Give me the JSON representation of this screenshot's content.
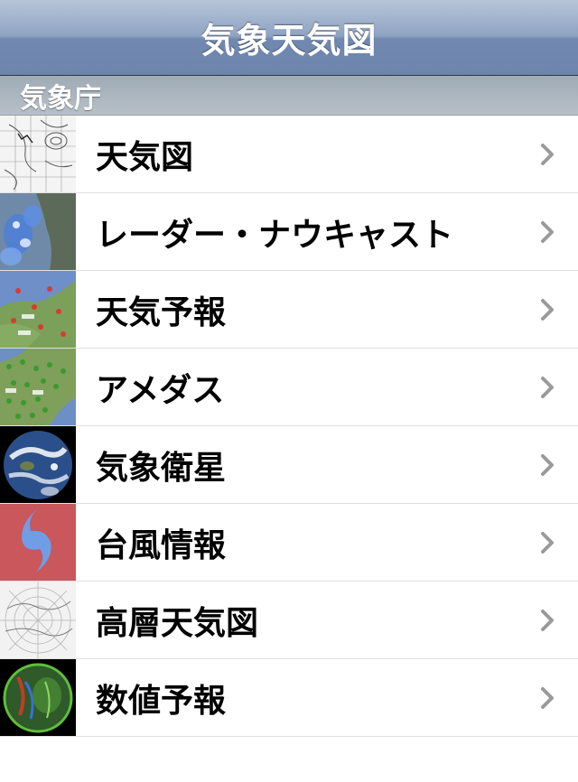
{
  "navbar": {
    "title": "気象天気図"
  },
  "section": {
    "header": "気象庁"
  },
  "items": [
    {
      "label": "天気図",
      "icon": "weather-map-icon"
    },
    {
      "label": "レーダー・ナウキャスト",
      "icon": "radar-icon"
    },
    {
      "label": "天気予報",
      "icon": "forecast-map-icon"
    },
    {
      "label": "アメダス",
      "icon": "amedas-map-icon"
    },
    {
      "label": "気象衛星",
      "icon": "satellite-globe-icon"
    },
    {
      "label": "台風情報",
      "icon": "typhoon-icon"
    },
    {
      "label": "高層天気図",
      "icon": "upper-air-map-icon"
    },
    {
      "label": "数値予報",
      "icon": "numerical-forecast-globe-icon"
    }
  ],
  "colors": {
    "navbar_top": "#b7c5d9",
    "navbar_bottom": "#6d85ad",
    "typhoon_bg": "#c9575c",
    "typhoon_symbol": "#6f9ee6"
  }
}
